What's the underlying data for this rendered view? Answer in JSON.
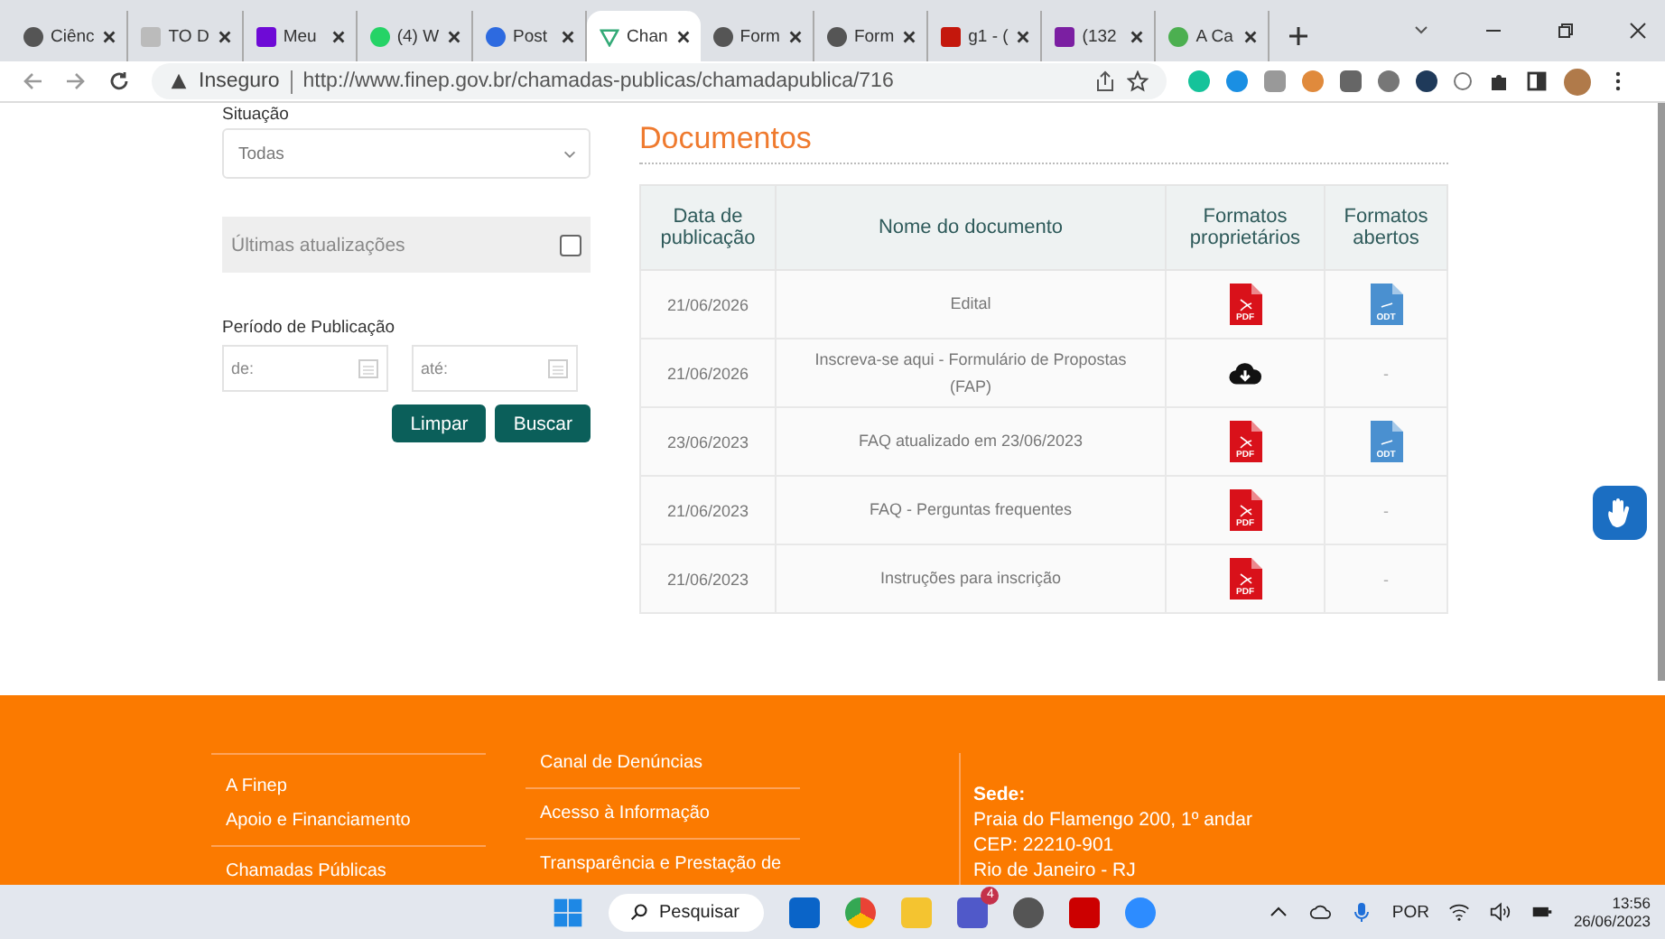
{
  "browser": {
    "tabs": [
      {
        "title": "Ciênc",
        "selected": false
      },
      {
        "title": "TO D",
        "selected": false
      },
      {
        "title": "Meu",
        "selected": false
      },
      {
        "title": "(4) W",
        "selected": false
      },
      {
        "title": "Post",
        "selected": false
      },
      {
        "title": "Chan",
        "selected": true
      },
      {
        "title": "Form",
        "selected": false
      },
      {
        "title": "Form",
        "selected": false
      },
      {
        "title": "g1 - (",
        "selected": false
      },
      {
        "title": "(132",
        "selected": false
      },
      {
        "title": "A Ca",
        "selected": false
      }
    ],
    "security": "Inseguro",
    "url": "http://www.finep.gov.br/chamadas-publicas/chamadapublica/716"
  },
  "filters": {
    "situacao_label": "Situação",
    "situacao_value": "Todas",
    "latest_label": "Últimas atualizações",
    "latest_checked": false,
    "period_label": "Período de Publicação",
    "from_placeholder": "de:",
    "to_placeholder": "até:",
    "buttons": [
      "Limpar",
      "Buscar"
    ]
  },
  "documents": {
    "title": "Documentos",
    "columns": [
      "Data de publicação",
      "Nome do documento",
      "Formatos proprietários",
      "Formatos abertos"
    ],
    "rows": [
      {
        "date": "21/06/2026",
        "name": "Edital",
        "proprietary": {
          "kind": "pdf",
          "label": "PDF"
        },
        "open": {
          "kind": "odt",
          "label": "ODT"
        }
      },
      {
        "date": "21/06/2026",
        "name": "Inscreva-se aqui - Formulário de Propostas (FAP)",
        "proprietary": {
          "kind": "cloud"
        },
        "open": {
          "kind": "none",
          "label": "-"
        }
      },
      {
        "date": "23/06/2023",
        "name": "FAQ atualizado em 23/06/2023",
        "proprietary": {
          "kind": "pdf",
          "label": "PDF"
        },
        "open": {
          "kind": "odt",
          "label": "ODT"
        }
      },
      {
        "date": "21/06/2023",
        "name": "FAQ - Perguntas frequentes",
        "proprietary": {
          "kind": "pdf",
          "label": "PDF"
        },
        "open": {
          "kind": "none",
          "label": "-"
        }
      },
      {
        "date": "21/06/2023",
        "name": "Instruções para inscrição",
        "proprietary": {
          "kind": "pdf",
          "label": "PDF"
        },
        "open": {
          "kind": "none",
          "label": "-"
        }
      }
    ]
  },
  "footer": {
    "column_1": [
      "A Finep",
      "Apoio e Financiamento",
      "Chamadas Públicas"
    ],
    "column_2": [
      "Canal de Denúncias",
      "Acesso à Informação",
      "Transparência e Prestação de"
    ],
    "sede_title": "Sede:",
    "sede_lines": [
      "Praia do Flamengo 200, 1º andar",
      "CEP: 22210-901",
      "Rio de Janeiro - RJ"
    ]
  },
  "taskbar": {
    "search": "Pesquisar",
    "teams_badge": "4",
    "language": "POR",
    "time": "13:56",
    "date": "26/06/2023"
  }
}
